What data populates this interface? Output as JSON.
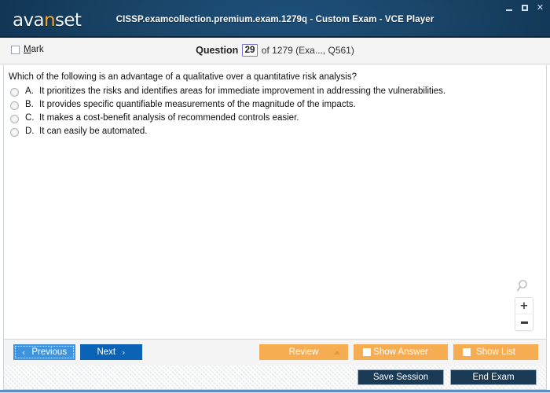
{
  "window": {
    "logo_main_a": "ava",
    "logo_accent": "n",
    "logo_main_b": "set",
    "title": "CISSP.examcollection.premium.exam.1279q - Custom Exam - VCE Player",
    "controls": {
      "minimize": "minimize-icon",
      "maximize": "maximize-icon",
      "close": "✕"
    },
    "accent_color": "#f4a72c",
    "titlebar_color": "#1a4669"
  },
  "question_header": {
    "mark_label_accel": "M",
    "mark_label_rest": "ark",
    "mark_checked": false,
    "counter_word": "Question",
    "counter_number": "29",
    "counter_rest": "of 1279 (Exa..., Q561)"
  },
  "question": {
    "text": "Which of the following is an advantage of a qualitative over a quantitative risk analysis?",
    "selected": null,
    "options": [
      {
        "letter": "A.",
        "text": "It prioritizes the risks and identifies areas for immediate improvement in addressing the vulnerabilities."
      },
      {
        "letter": "B.",
        "text": "It provides specific quantifiable measurements of the magnitude of the impacts."
      },
      {
        "letter": "C.",
        "text": "It makes a cost-benefit analysis of recommended controls easier."
      },
      {
        "letter": "D.",
        "text": "It can easily be automated."
      }
    ]
  },
  "zoom_widget": {
    "magnifier_icon": "magnifier-icon",
    "zoom_in": "+",
    "zoom_out": "−"
  },
  "action_bar": {
    "previous_label": "Previous",
    "previous_chevron": "‹",
    "next_label": "Next",
    "next_chevron": "›",
    "review_label": "Review",
    "show_answer_label": "Show Answer",
    "show_list_label": "Show List",
    "show_answer_checked": false,
    "show_list_checked": false,
    "orange_color": "#f6ad52",
    "next_color": "#0a63b5",
    "previous_color": "#3f93dd"
  },
  "status_bar": {
    "save_session_label": "Save Session",
    "end_exam_label": "End Exam",
    "dark_button_color": "#1b3a56"
  }
}
